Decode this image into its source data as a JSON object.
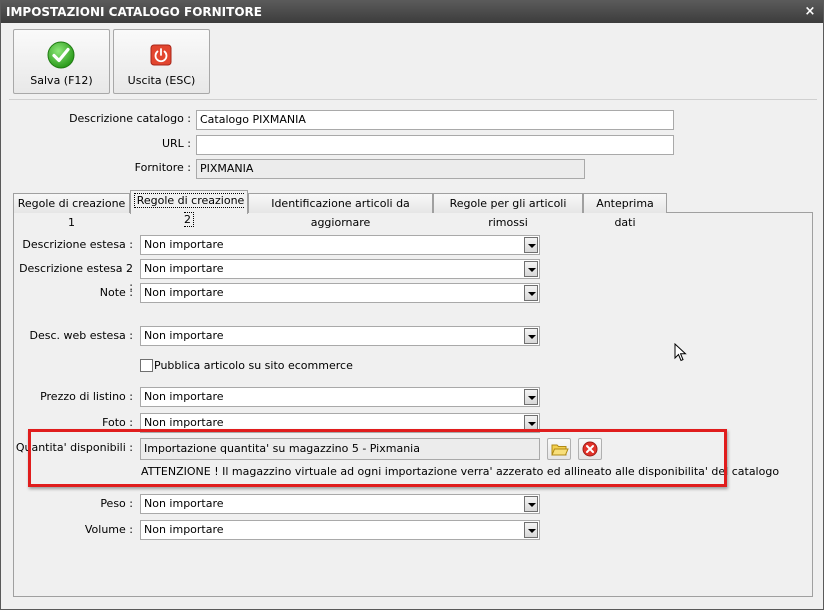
{
  "window": {
    "title": "IMPOSTAZIONI CATALOGO FORNITORE",
    "close_label": "×"
  },
  "toolbar": {
    "save_label": "Salva (F12)",
    "exit_label": "Uscita (ESC)"
  },
  "form": {
    "descrizione_label": "Descrizione catalogo :",
    "descrizione_value": "Catalogo PIXMANIA",
    "url_label": "URL :",
    "url_value": "",
    "fornitore_label": "Fornitore :",
    "fornitore_value": "PIXMANIA"
  },
  "tabs": [
    {
      "label": "Regole di creazione 1"
    },
    {
      "label": "Regole di creazione 2"
    },
    {
      "label": "Identificazione articoli da aggiornare"
    },
    {
      "label": "Regole per gli articoli rimossi"
    },
    {
      "label": "Anteprima dati"
    }
  ],
  "active_tab": "Regole di creazione 2",
  "rules": {
    "descrizione_estesa": {
      "label": "Descrizione estesa :",
      "value": "Non importare"
    },
    "descrizione_estesa_2": {
      "label": "Descrizione estesa 2 :",
      "value": "Non importare"
    },
    "note": {
      "label": "Note :",
      "value": "Non importare"
    },
    "desc_web_estesa": {
      "label": "Desc. web estesa :",
      "value": "Non importare"
    },
    "pubblica": {
      "label": "Pubblica articolo su sito ecommerce",
      "checked": false
    },
    "prezzo_listino": {
      "label": "Prezzo di listino :",
      "value": "Non importare"
    },
    "foto": {
      "label": "Foto :",
      "value": "Non importare"
    },
    "quantita": {
      "label": "Quantita' disponibili :",
      "value": "Importazione quantita' su magazzino 5 - Pixmania",
      "warning": "ATTENZIONE ! Il magazzino virtuale ad ogni importazione verra' azzerato ed allineato alle disponibilita' del catalogo"
    },
    "peso": {
      "label": "Peso :",
      "value": "Non importare"
    },
    "volume": {
      "label": "Volume :",
      "value": "Non importare"
    }
  },
  "colors": {
    "highlight": "#e01d1d",
    "titlebar": "#4a4a4a"
  }
}
